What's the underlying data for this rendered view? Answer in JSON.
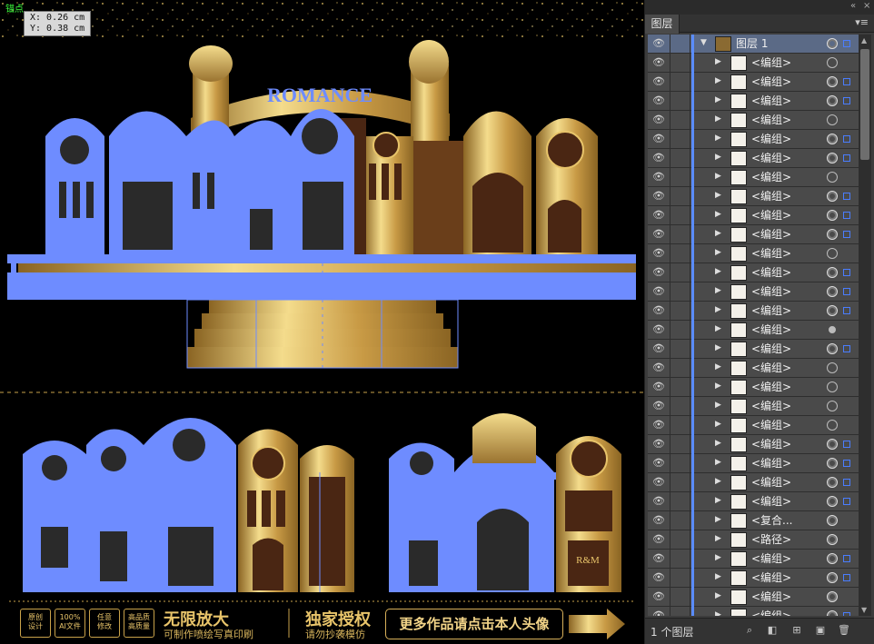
{
  "canvas": {
    "anchor_label": "锚点",
    "coordinates": "X: 0.26 cm\nY: 0.38 cm",
    "footer": {
      "badges": [
        "原创\n设计",
        "100%\nAI文件",
        "任意\n修改",
        "高品质\n高质量"
      ],
      "tagline_1_main": "无限放大",
      "tagline_1_sub": "可制作喷绘写真印刷",
      "tagline_2_main": "独家授权",
      "tagline_2_sub": "请勿抄袭模仿",
      "more_button": "更多作品请点击本人头像",
      "arrow_icon": "arrow-right-icon"
    },
    "artwork": {
      "sign_text": "ROMANCE",
      "monogram": "R&M"
    },
    "colors": {
      "gold": "#d4a84f",
      "gold_light": "#f4dc8c",
      "gold_dark": "#8a6423",
      "selection": "#6e8cff",
      "brown": "#4a2613"
    }
  },
  "panel": {
    "tab_label": "图层",
    "collapse_icon": "«",
    "close_icon": "×",
    "menu_icon": "▾≡",
    "top_layer": {
      "name": "图层 1"
    },
    "rows": [
      {
        "name": "<编组>",
        "target": "ring",
        "selected": false
      },
      {
        "name": "<编组>",
        "target": "filled",
        "selected": true
      },
      {
        "name": "<编组>",
        "target": "filled",
        "selected": true
      },
      {
        "name": "<编组>",
        "target": "ring",
        "selected": false
      },
      {
        "name": "<编组>",
        "target": "filled",
        "selected": true
      },
      {
        "name": "<编组>",
        "target": "filled",
        "selected": true
      },
      {
        "name": "<编组>",
        "target": "ring",
        "selected": false
      },
      {
        "name": "<编组>",
        "target": "filled",
        "selected": true
      },
      {
        "name": "<编组>",
        "target": "filled",
        "selected": true
      },
      {
        "name": "<编组>",
        "target": "filled",
        "selected": true
      },
      {
        "name": "<编组>",
        "target": "ring",
        "selected": false
      },
      {
        "name": "<编组>",
        "target": "filled",
        "selected": true
      },
      {
        "name": "<编组>",
        "target": "filled",
        "selected": true
      },
      {
        "name": "<编组>",
        "target": "filled",
        "selected": true
      },
      {
        "name": "<编组>",
        "target": "dot",
        "selected": false
      },
      {
        "name": "<编组>",
        "target": "filled",
        "selected": true
      },
      {
        "name": "<编组>",
        "target": "ring",
        "selected": false
      },
      {
        "name": "<编组>",
        "target": "ring",
        "selected": false
      },
      {
        "name": "<编组>",
        "target": "ring",
        "selected": false
      },
      {
        "name": "<编组>",
        "target": "ring",
        "selected": false
      },
      {
        "name": "<编组>",
        "target": "filled",
        "selected": true
      },
      {
        "name": "<编组>",
        "target": "filled",
        "selected": true
      },
      {
        "name": "<编组>",
        "target": "filled",
        "selected": true
      },
      {
        "name": "<编组>",
        "target": "filled",
        "selected": true
      },
      {
        "name": "<复合...",
        "target": "filled",
        "selected": false
      },
      {
        "name": "<路径>",
        "target": "filled",
        "selected": false
      },
      {
        "name": "<编组>",
        "target": "filled",
        "selected": true
      },
      {
        "name": "<编组>",
        "target": "filled",
        "selected": true
      },
      {
        "name": "<编组>",
        "target": "filled",
        "selected": false
      },
      {
        "name": "<编组>",
        "target": "filled",
        "selected": true
      }
    ],
    "footer": {
      "layer_count": "1 个图层",
      "icons": [
        "locate-object-icon",
        "make-clip-mask-icon",
        "new-sublayer-icon",
        "new-layer-icon",
        "delete-layer-icon"
      ]
    }
  }
}
